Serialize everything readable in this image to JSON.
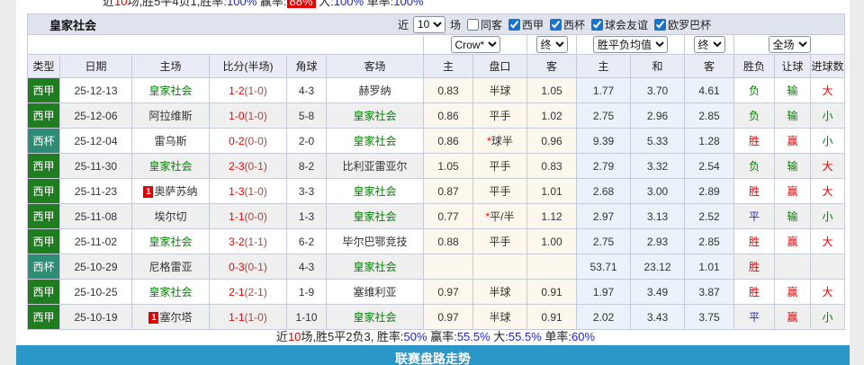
{
  "colors": {
    "accent_red": "#e60000",
    "accent_green": "#008000",
    "accent_blue": "#2323cc",
    "liga_badge_green": "#1e7d1e",
    "cup_badge_teal": "#2e8b74",
    "footer_bar_blue": "#2b96c8",
    "band_bg": "#dfe3ee",
    "asian_cols_bg": "#fdf8ed",
    "euro_cols_bg": "#eaf3fa"
  },
  "top_line": {
    "segments": [
      {
        "t": "近"
      },
      {
        "t": "10",
        "c": "red"
      },
      {
        "t": "场,胜5平4负1,胜率:"
      },
      {
        "t": "100%",
        "c": "blue"
      },
      {
        "t": " 赢率:"
      },
      {
        "t": "88%",
        "c": "hl"
      },
      {
        "t": " 大:"
      },
      {
        "t": "100%",
        "c": "blue"
      },
      {
        "t": " 单率:"
      },
      {
        "t": "100%",
        "c": "blue"
      }
    ]
  },
  "panel": {
    "team_name": "皇家社会"
  },
  "filters": {
    "recent_label": "近",
    "recent_count": "10",
    "matches_label": "场",
    "same_venue_label": "同客",
    "same_venue_checked": false,
    "leagues": [
      {
        "label": "西甲",
        "checked": true
      },
      {
        "label": "西杯",
        "checked": true
      },
      {
        "label": "球会友谊",
        "checked": true
      },
      {
        "label": "欧罗巴杯",
        "checked": true
      }
    ]
  },
  "controls": {
    "bookmaker": "Crow*",
    "asian_time": "终",
    "euro_source": "胜平负均值",
    "euro_time": "终",
    "scope": "全场"
  },
  "table": {
    "columns": [
      "类型",
      "日期",
      "主场",
      "比分(半场)",
      "角球",
      "客场",
      "主",
      "盘口",
      "客",
      "主",
      "和",
      "客",
      "胜负",
      "让球",
      "进球数"
    ],
    "rows": [
      {
        "type": "西甲",
        "cup": false,
        "date": "25-12-13",
        "home": {
          "name": "皇家社会",
          "target": true,
          "badge": ""
        },
        "ft": "1-2",
        "ht": "(1-0)",
        "corners": "4-3",
        "away": {
          "name": "赫罗纳",
          "target": false,
          "badge": ""
        },
        "ah_home": "0.83",
        "line": "半球",
        "line_star": false,
        "ah_away": "1.05",
        "eu_home": "1.77",
        "eu_draw": "3.70",
        "eu_away": "4.61",
        "res": "负",
        "res_c": "g",
        "hres": "输",
        "hres_c": "g",
        "gres": "大",
        "gres_c": "r"
      },
      {
        "type": "西甲",
        "cup": false,
        "date": "25-12-06",
        "home": {
          "name": "阿拉维斯",
          "target": false,
          "badge": ""
        },
        "ft": "1-0",
        "ht": "(1-0)",
        "corners": "5-8",
        "away": {
          "name": "皇家社会",
          "target": true,
          "badge": ""
        },
        "ah_home": "0.86",
        "line": "平手",
        "line_star": false,
        "ah_away": "1.02",
        "eu_home": "2.75",
        "eu_draw": "2.96",
        "eu_away": "2.85",
        "res": "负",
        "res_c": "g",
        "hres": "输",
        "hres_c": "g",
        "gres": "小",
        "gres_c": "g"
      },
      {
        "type": "西杯",
        "cup": true,
        "date": "25-12-04",
        "home": {
          "name": "雷乌斯",
          "target": false,
          "badge": ""
        },
        "ft": "0-2",
        "ht": "(0-0)",
        "corners": "2-0",
        "away": {
          "name": "皇家社会",
          "target": true,
          "badge": ""
        },
        "ah_home": "0.86",
        "line": "球半",
        "line_star": true,
        "ah_away": "0.96",
        "eu_home": "9.39",
        "eu_draw": "5.33",
        "eu_away": "1.28",
        "res": "胜",
        "res_c": "r",
        "hres": "赢",
        "hres_c": "r",
        "gres": "小",
        "gres_c": "g"
      },
      {
        "type": "西甲",
        "cup": false,
        "date": "25-11-30",
        "home": {
          "name": "皇家社会",
          "target": true,
          "badge": ""
        },
        "ft": "2-3",
        "ht": "(0-1)",
        "corners": "8-2",
        "away": {
          "name": "比利亚雷亚尔",
          "target": false,
          "badge": ""
        },
        "ah_home": "1.05",
        "line": "平手",
        "line_star": false,
        "ah_away": "0.83",
        "eu_home": "2.79",
        "eu_draw": "3.32",
        "eu_away": "2.54",
        "res": "负",
        "res_c": "g",
        "hres": "输",
        "hres_c": "g",
        "gres": "大",
        "gres_c": "r"
      },
      {
        "type": "西甲",
        "cup": false,
        "date": "25-11-23",
        "home": {
          "name": "奥萨苏纳",
          "target": false,
          "badge": "1"
        },
        "ft": "1-3",
        "ht": "(1-0)",
        "corners": "3-3",
        "away": {
          "name": "皇家社会",
          "target": true,
          "badge": ""
        },
        "ah_home": "0.87",
        "line": "平手",
        "line_star": false,
        "ah_away": "1.01",
        "eu_home": "2.68",
        "eu_draw": "3.00",
        "eu_away": "2.89",
        "res": "胜",
        "res_c": "r",
        "hres": "赢",
        "hres_c": "r",
        "gres": "大",
        "gres_c": "r"
      },
      {
        "type": "西甲",
        "cup": false,
        "date": "25-11-08",
        "home": {
          "name": "埃尔切",
          "target": false,
          "badge": ""
        },
        "ft": "1-1",
        "ht": "(0-0)",
        "corners": "1-3",
        "away": {
          "name": "皇家社会",
          "target": true,
          "badge": ""
        },
        "ah_home": "0.77",
        "line": "平/半",
        "line_star": true,
        "ah_away": "1.12",
        "eu_home": "2.97",
        "eu_draw": "3.13",
        "eu_away": "2.52",
        "res": "平",
        "res_c": "b",
        "hres": "输",
        "hres_c": "g",
        "gres": "小",
        "gres_c": "g"
      },
      {
        "type": "西甲",
        "cup": false,
        "date": "25-11-02",
        "home": {
          "name": "皇家社会",
          "target": true,
          "badge": ""
        },
        "ft": "3-2",
        "ht": "(1-1)",
        "corners": "6-2",
        "away": {
          "name": "毕尔巴鄂竞技",
          "target": false,
          "badge": ""
        },
        "ah_home": "0.88",
        "line": "平手",
        "line_star": false,
        "ah_away": "1.00",
        "eu_home": "2.75",
        "eu_draw": "2.93",
        "eu_away": "2.85",
        "res": "胜",
        "res_c": "r",
        "hres": "赢",
        "hres_c": "r",
        "gres": "大",
        "gres_c": "r"
      },
      {
        "type": "西杯",
        "cup": true,
        "date": "25-10-29",
        "home": {
          "name": "尼格雷亚",
          "target": false,
          "badge": ""
        },
        "ft": "0-3",
        "ht": "(0-1)",
        "corners": "4-3",
        "away": {
          "name": "皇家社会",
          "target": true,
          "badge": ""
        },
        "ah_home": "",
        "line": "",
        "line_star": false,
        "ah_away": "",
        "eu_home": "53.71",
        "eu_draw": "23.12",
        "eu_away": "1.01",
        "res": "胜",
        "res_c": "r",
        "hres": "",
        "hres_c": "g",
        "gres": "",
        "gres_c": "g"
      },
      {
        "type": "西甲",
        "cup": false,
        "date": "25-10-25",
        "home": {
          "name": "皇家社会",
          "target": true,
          "badge": ""
        },
        "ft": "2-1",
        "ht": "(2-1)",
        "corners": "1-9",
        "away": {
          "name": "塞维利亚",
          "target": false,
          "badge": ""
        },
        "ah_home": "0.97",
        "line": "半球",
        "line_star": false,
        "ah_away": "0.91",
        "eu_home": "1.97",
        "eu_draw": "3.49",
        "eu_away": "3.87",
        "res": "胜",
        "res_c": "r",
        "hres": "赢",
        "hres_c": "r",
        "gres": "大",
        "gres_c": "r"
      },
      {
        "type": "西甲",
        "cup": false,
        "date": "25-10-19",
        "home": {
          "name": "塞尔塔",
          "target": false,
          "badge": "1"
        },
        "ft": "1-1",
        "ht": "(1-0)",
        "corners": "1-10",
        "away": {
          "name": "皇家社会",
          "target": true,
          "badge": ""
        },
        "ah_home": "0.97",
        "line": "半球",
        "line_star": false,
        "ah_away": "0.91",
        "eu_home": "2.02",
        "eu_draw": "3.43",
        "eu_away": "3.75",
        "res": "平",
        "res_c": "b",
        "hres": "赢",
        "hres_c": "r",
        "gres": "小",
        "gres_c": "g"
      }
    ]
  },
  "summary": {
    "segments": [
      {
        "t": "近"
      },
      {
        "t": "10",
        "c": "red"
      },
      {
        "t": "场,胜5平2负3, 胜率:"
      },
      {
        "t": "50%",
        "c": "blue"
      },
      {
        "t": " 赢率:"
      },
      {
        "t": "55.5%",
        "c": "blue"
      },
      {
        "t": " 大:"
      },
      {
        "t": "55.5%",
        "c": "blue"
      },
      {
        "t": " 单率:"
      },
      {
        "t": "60%",
        "c": "blue"
      }
    ]
  },
  "footer_bar": {
    "label": "联赛盘路走势"
  }
}
